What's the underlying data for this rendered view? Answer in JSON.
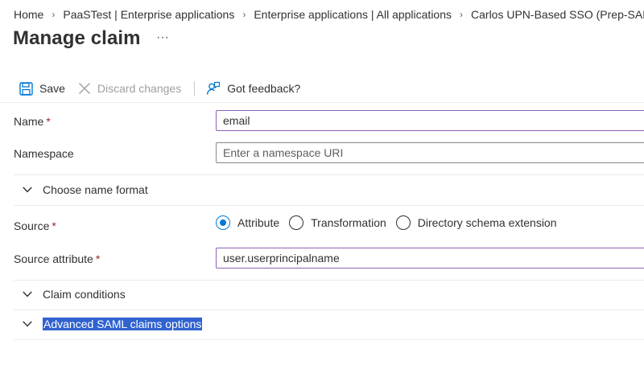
{
  "breadcrumb": [
    {
      "label": "Home"
    },
    {
      "label": "PaaSTest | Enterprise applications"
    },
    {
      "label": "Enterprise applications | All applications"
    },
    {
      "label": "Carlos UPN-Based SSO (Prep-SAML)"
    }
  ],
  "page": {
    "title": "Manage claim",
    "more_glyph": "···"
  },
  "toolbar": {
    "save_label": "Save",
    "discard_label": "Discard changes",
    "feedback_label": "Got feedback?"
  },
  "form": {
    "name": {
      "label": "Name",
      "required_mark": "*",
      "value": "email"
    },
    "namespace": {
      "label": "Namespace",
      "placeholder": "Enter a namespace URI",
      "value": ""
    },
    "name_format": {
      "label": "Choose name format",
      "expanded": false
    },
    "source": {
      "label": "Source",
      "required_mark": "*",
      "options": [
        {
          "label": "Attribute",
          "checked": true
        },
        {
          "label": "Transformation",
          "checked": false
        },
        {
          "label": "Directory schema extension",
          "checked": false
        }
      ]
    },
    "source_attribute": {
      "label": "Source attribute",
      "required_mark": "*",
      "value": "user.userprincipalname"
    },
    "claim_conditions": {
      "label": "Claim conditions",
      "expanded": false
    },
    "advanced": {
      "label": "Advanced SAML claims options",
      "expanded": false,
      "text_selected": true
    }
  },
  "colors": {
    "accent": "#0078d4",
    "required": "#a4262c",
    "selection": "#3063d0",
    "focused_border": "#8d64b5"
  }
}
